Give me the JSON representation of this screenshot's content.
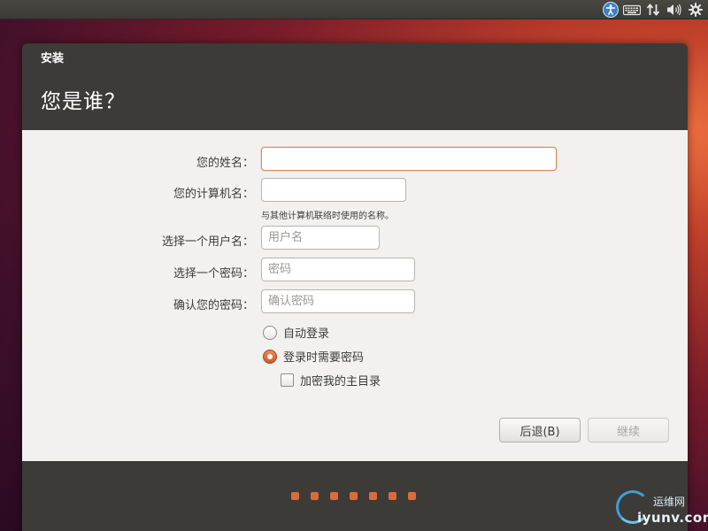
{
  "tray": {
    "icons": [
      "accessibility-icon",
      "keyboard-icon",
      "network-icon",
      "volume-icon",
      "gear-icon"
    ]
  },
  "window": {
    "title": "安装",
    "heading": "您是谁？"
  },
  "form": {
    "name_label": "您的姓名：",
    "name_value": "",
    "computer_label": "您的计算机名：",
    "computer_value": "",
    "computer_hint": "与其他计算机联络时使用的名称。",
    "username_label": "选择一个用户名：",
    "username_placeholder": "用户名",
    "password_label": "选择一个密码：",
    "password_placeholder": "密码",
    "confirm_label": "确认您的密码：",
    "confirm_placeholder": "确认密码",
    "auto_login_label": "自动登录",
    "require_password_label": "登录时需要密码",
    "encrypt_home_label": "加密我的主目录",
    "login_mode_selected": "require_password",
    "encrypt_home_checked": false
  },
  "buttons": {
    "back_label": "后退(B)",
    "continue_label": "继续"
  },
  "progress": {
    "steps": 7
  },
  "watermark": {
    "cn": "运维网",
    "en": "iyunv.com"
  },
  "colors": {
    "accent": "#dd6a3a",
    "window_bg": "#3c3b37",
    "content_bg": "#f2f1f0"
  }
}
